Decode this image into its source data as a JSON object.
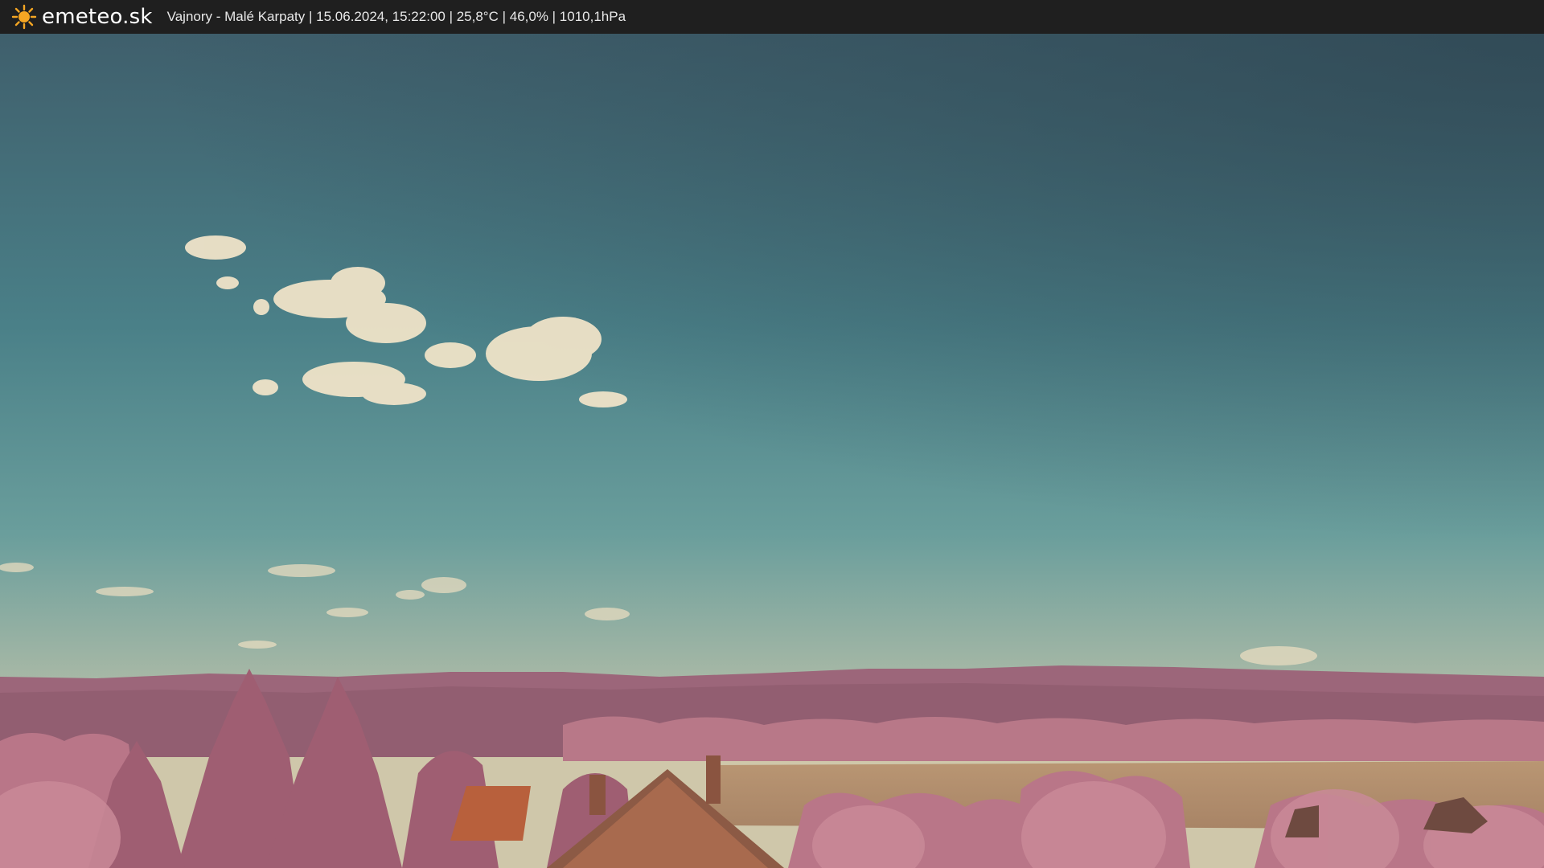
{
  "header": {
    "brand": "emeteo.sk",
    "caption": "Vajnory - Malé Karpaty | 15.06.2024, 15:22:00 | 25,8°C | 46,0% | 1010,1hPa",
    "logo_icon": "sun-icon",
    "background": "#1f1f1f",
    "brand_color": "#ffffff",
    "sun_color": "#f5a623"
  },
  "scene": {
    "sky_top": "#3d5a66",
    "sky_mid": "#4d8a92",
    "sky_horizon": "#c9c4a6",
    "hills_color": "#9a6478",
    "foliage_color": "#c0808e",
    "field_color": "#b08a6a",
    "roof_color": "#b8603c"
  }
}
